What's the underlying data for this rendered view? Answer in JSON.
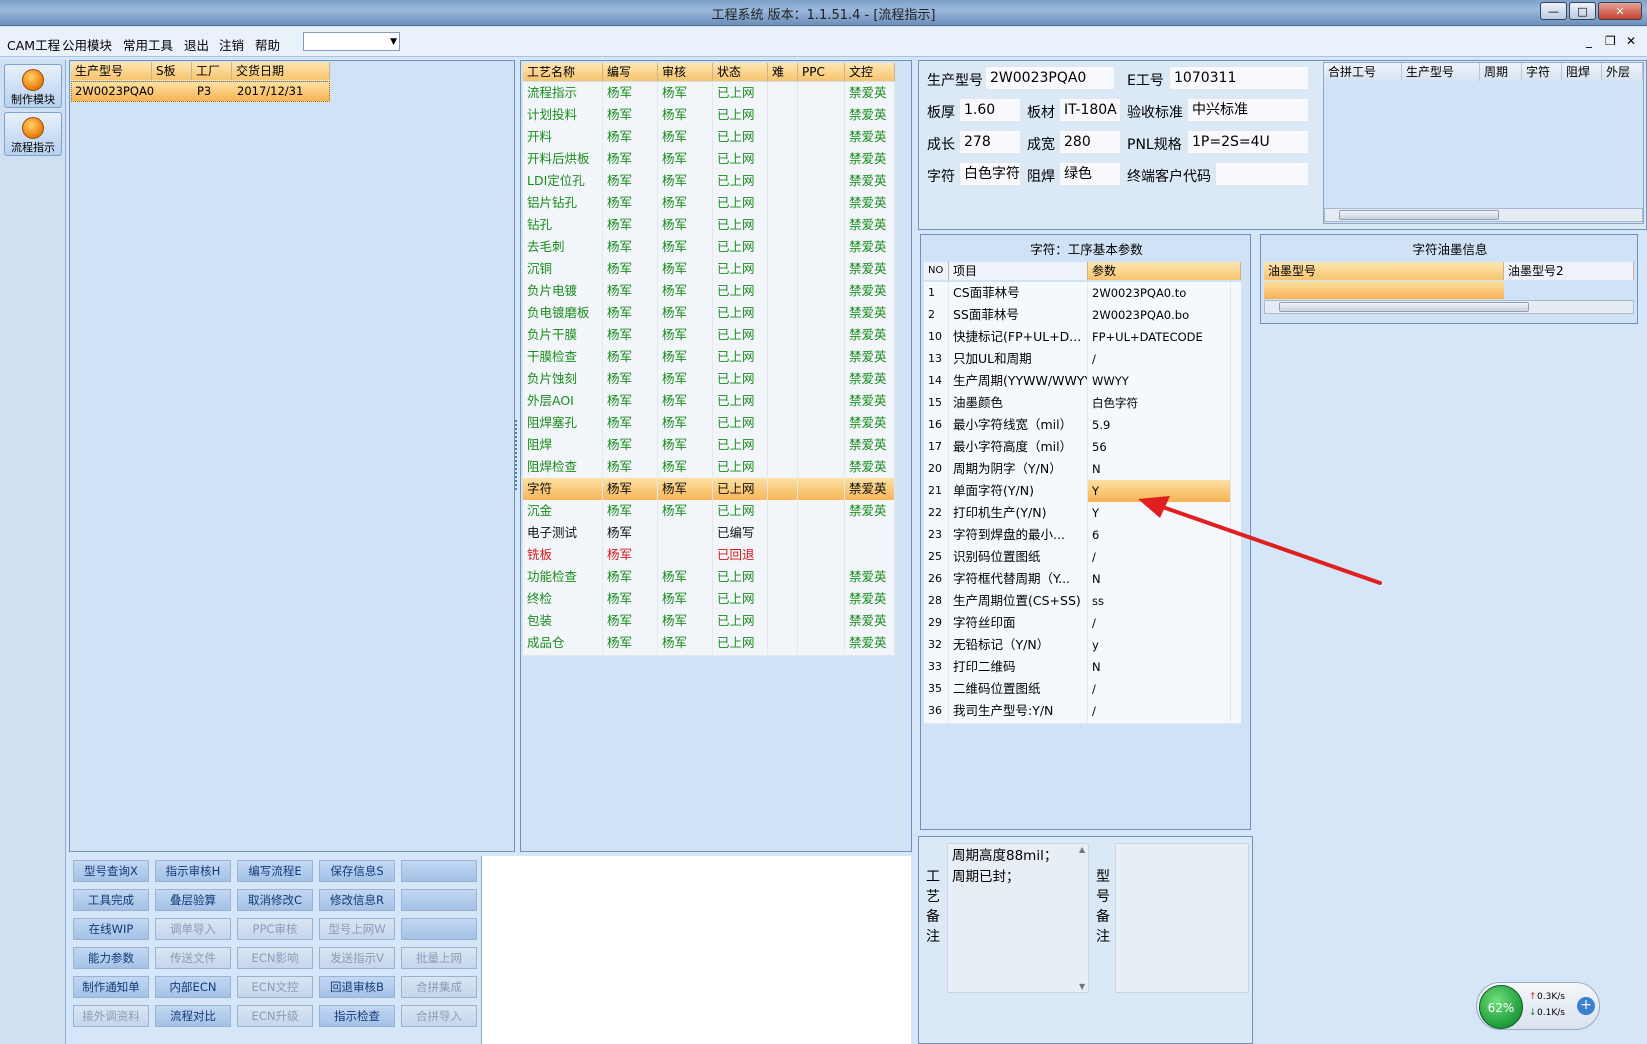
{
  "window": {
    "title": "工程系统   版本：1.1.51.4 - [流程指示]"
  },
  "menu": {
    "items": [
      "CAM工程",
      "公用模块",
      "常用工具",
      "退出",
      "注销",
      "帮助"
    ],
    "select_value": ""
  },
  "leftnav": {
    "items": [
      "制作模块",
      "流程指示"
    ]
  },
  "orders": {
    "headers": [
      "生产型号",
      "S板",
      "工厂",
      "交货日期"
    ],
    "rows": [
      [
        "2W0023PQA0",
        "",
        "P3",
        "2017/12/31"
      ]
    ]
  },
  "process": {
    "headers": [
      "工艺名称",
      "编写",
      "审核",
      "状态",
      "难",
      "PPC",
      "文控"
    ],
    "rows": [
      {
        "name": "流程指示",
        "w": "杨军",
        "r": "杨军",
        "s": "已上网",
        "d": "",
        "p": "",
        "c": "禁爱英",
        "color": "green"
      },
      {
        "name": "计划投料",
        "w": "杨军",
        "r": "杨军",
        "s": "已上网",
        "d": "",
        "p": "",
        "c": "禁爱英",
        "color": "green"
      },
      {
        "name": "开料",
        "w": "杨军",
        "r": "杨军",
        "s": "已上网",
        "d": "",
        "p": "",
        "c": "禁爱英",
        "color": "green"
      },
      {
        "name": "开料后烘板",
        "w": "杨军",
        "r": "杨军",
        "s": "已上网",
        "d": "",
        "p": "",
        "c": "禁爱英",
        "color": "green"
      },
      {
        "name": "LDI定位孔",
        "w": "杨军",
        "r": "杨军",
        "s": "已上网",
        "d": "",
        "p": "",
        "c": "禁爱英",
        "color": "green"
      },
      {
        "name": "铝片钻孔",
        "w": "杨军",
        "r": "杨军",
        "s": "已上网",
        "d": "",
        "p": "",
        "c": "禁爱英",
        "color": "green"
      },
      {
        "name": "钻孔",
        "w": "杨军",
        "r": "杨军",
        "s": "已上网",
        "d": "",
        "p": "",
        "c": "禁爱英",
        "color": "green"
      },
      {
        "name": "去毛刺",
        "w": "杨军",
        "r": "杨军",
        "s": "已上网",
        "d": "",
        "p": "",
        "c": "禁爱英",
        "color": "green"
      },
      {
        "name": "沉铜",
        "w": "杨军",
        "r": "杨军",
        "s": "已上网",
        "d": "",
        "p": "",
        "c": "禁爱英",
        "color": "green"
      },
      {
        "name": "负片电镀",
        "w": "杨军",
        "r": "杨军",
        "s": "已上网",
        "d": "",
        "p": "",
        "c": "禁爱英",
        "color": "green"
      },
      {
        "name": "负电镀磨板",
        "w": "杨军",
        "r": "杨军",
        "s": "已上网",
        "d": "",
        "p": "",
        "c": "禁爱英",
        "color": "green"
      },
      {
        "name": "负片干膜",
        "w": "杨军",
        "r": "杨军",
        "s": "已上网",
        "d": "",
        "p": "",
        "c": "禁爱英",
        "color": "green"
      },
      {
        "name": "干膜检查",
        "w": "杨军",
        "r": "杨军",
        "s": "已上网",
        "d": "",
        "p": "",
        "c": "禁爱英",
        "color": "green"
      },
      {
        "name": "负片蚀刻",
        "w": "杨军",
        "r": "杨军",
        "s": "已上网",
        "d": "",
        "p": "",
        "c": "禁爱英",
        "color": "green"
      },
      {
        "name": "外层AOI",
        "w": "杨军",
        "r": "杨军",
        "s": "已上网",
        "d": "",
        "p": "",
        "c": "禁爱英",
        "color": "green"
      },
      {
        "name": "阻焊塞孔",
        "w": "杨军",
        "r": "杨军",
        "s": "已上网",
        "d": "",
        "p": "",
        "c": "禁爱英",
        "color": "green"
      },
      {
        "name": "阻焊",
        "w": "杨军",
        "r": "杨军",
        "s": "已上网",
        "d": "",
        "p": "",
        "c": "禁爱英",
        "color": "green"
      },
      {
        "name": "阻焊检查",
        "w": "杨军",
        "r": "杨军",
        "s": "已上网",
        "d": "",
        "p": "",
        "c": "禁爱英",
        "color": "green"
      },
      {
        "name": "字符",
        "w": "杨军",
        "r": "杨军",
        "s": "已上网",
        "d": "",
        "p": "",
        "c": "禁爱英",
        "color": "black",
        "selected": true
      },
      {
        "name": "沉金",
        "w": "杨军",
        "r": "杨军",
        "s": "已上网",
        "d": "",
        "p": "",
        "c": "禁爱英",
        "color": "green"
      },
      {
        "name": "电子测试",
        "w": "杨军",
        "r": "",
        "s": "已编写",
        "d": "",
        "p": "",
        "c": "",
        "color": "black"
      },
      {
        "name": "铣板",
        "w": "杨军",
        "r": "",
        "s": "已回退",
        "d": "",
        "p": "",
        "c": "",
        "color": "red"
      },
      {
        "name": "功能检查",
        "w": "杨军",
        "r": "杨军",
        "s": "已上网",
        "d": "",
        "p": "",
        "c": "禁爱英",
        "color": "green"
      },
      {
        "name": "终检",
        "w": "杨军",
        "r": "杨军",
        "s": "已上网",
        "d": "",
        "p": "",
        "c": "禁爱英",
        "color": "green"
      },
      {
        "name": "包装",
        "w": "杨军",
        "r": "杨军",
        "s": "已上网",
        "d": "",
        "p": "",
        "c": "禁爱英",
        "color": "green"
      },
      {
        "name": "成品仓",
        "w": "杨军",
        "r": "杨军",
        "s": "已上网",
        "d": "",
        "p": "",
        "c": "禁爱英",
        "color": "green"
      }
    ]
  },
  "info": {
    "model_label": "生产型号",
    "model": "2W0023PQA0",
    "eno_label": "E工号",
    "eno": "1070311",
    "thick_label": "板厚",
    "thick": "1.60",
    "material_label": "板材",
    "material": "IT-180A",
    "accept_label": "验收标准",
    "accept": "中兴标准",
    "len_label": "成长",
    "len": "278",
    "wid_label": "成宽",
    "wid": "280",
    "pnl_label": "PNL规格",
    "pnl": "1P=2S=4U",
    "char_label": "字符",
    "char": "白色字符",
    "mask_label": "阻焊",
    "mask": "绿色",
    "cust_label": "终端客户代码",
    "cust": ""
  },
  "merge": {
    "headers": [
      "合拼工号",
      "生产型号",
      "周期",
      "字符",
      "阻焊",
      "外层"
    ]
  },
  "params": {
    "title": "字符：工序基本参数",
    "headers": [
      "NO",
      "项目",
      "参数"
    ],
    "rows": [
      {
        "no": "1",
        "item": "CS面菲林号",
        "val": "2W0023PQA0.to"
      },
      {
        "no": "2",
        "item": "SS面菲林号",
        "val": "2W0023PQA0.bo"
      },
      {
        "no": "10",
        "item": "快捷标记(FP+UL+D...",
        "val": "FP+UL+DATECODE"
      },
      {
        "no": "13",
        "item": "只加UL和周期",
        "val": "/"
      },
      {
        "no": "14",
        "item": "生产周期(YYWW/WWYY)",
        "val": "WWYY"
      },
      {
        "no": "15",
        "item": "油墨颜色",
        "val": "白色字符"
      },
      {
        "no": "16",
        "item": "最小字符线宽（mil）",
        "val": "5.9"
      },
      {
        "no": "17",
        "item": "最小字符高度（mil）",
        "val": "56"
      },
      {
        "no": "20",
        "item": "周期为阴字（Y/N）",
        "val": "N"
      },
      {
        "no": "21",
        "item": "单面字符(Y/N)",
        "val": "Y",
        "selected": true
      },
      {
        "no": "22",
        "item": "打印机生产(Y/N)",
        "val": "Y"
      },
      {
        "no": "23",
        "item": "字符到焊盘的最小...",
        "val": "6"
      },
      {
        "no": "25",
        "item": "识别码位置图纸",
        "val": "/"
      },
      {
        "no": "26",
        "item": "字符框代替周期（Y...",
        "val": "N"
      },
      {
        "no": "28",
        "item": "生产周期位置(CS+SS)",
        "val": "ss"
      },
      {
        "no": "29",
        "item": "字符丝印面",
        "val": "/"
      },
      {
        "no": "32",
        "item": "无铅标记（Y/N）",
        "val": "y"
      },
      {
        "no": "33",
        "item": "打印二维码",
        "val": "N"
      },
      {
        "no": "35",
        "item": "二维码位置图纸",
        "val": "/"
      },
      {
        "no": "36",
        "item": "我司生产型号:Y/N",
        "val": "/"
      }
    ]
  },
  "ink": {
    "title": "字符油墨信息",
    "headers": [
      "油墨型号",
      "油墨型号2"
    ]
  },
  "notes": {
    "process_label": [
      "工",
      "艺",
      "备",
      "注"
    ],
    "process_text": "周期高度88mil；\n周期已封；",
    "model_label": [
      "型",
      "号",
      "备",
      "注"
    ],
    "model_text": ""
  },
  "buttons": [
    [
      {
        "t": "型号查询X",
        "d": false
      },
      {
        "t": "指示审核H",
        "d": false
      },
      {
        "t": "编写流程E",
        "d": false
      },
      {
        "t": "保存信息S",
        "d": false
      },
      {
        "t": "",
        "d": false
      }
    ],
    [
      {
        "t": "工具完成",
        "d": false
      },
      {
        "t": "叠层验算",
        "d": false
      },
      {
        "t": "取消修改C",
        "d": false
      },
      {
        "t": "修改信息R",
        "d": false
      },
      {
        "t": "",
        "d": false
      }
    ],
    [
      {
        "t": "在线WIP",
        "d": false
      },
      {
        "t": "调单导入",
        "d": true
      },
      {
        "t": "PPC审核",
        "d": true
      },
      {
        "t": "型号上网W",
        "d": true
      },
      {
        "t": "",
        "d": false
      }
    ],
    [
      {
        "t": "能力参数",
        "d": false
      },
      {
        "t": "传送文件",
        "d": true
      },
      {
        "t": "ECN影响",
        "d": true
      },
      {
        "t": "发送指示V",
        "d": true
      },
      {
        "t": "批量上网",
        "d": true
      }
    ],
    [
      {
        "t": "制作通知单",
        "d": false
      },
      {
        "t": "内部ECN",
        "d": false
      },
      {
        "t": "ECN文控",
        "d": true
      },
      {
        "t": "回退审核B",
        "d": false
      },
      {
        "t": "合拼集成",
        "d": true
      }
    ],
    [
      {
        "t": "接外调资料",
        "d": true
      },
      {
        "t": "流程对比",
        "d": false
      },
      {
        "t": "ECN升级",
        "d": true
      },
      {
        "t": "指示检查",
        "d": false
      },
      {
        "t": "合拼导入",
        "d": true
      }
    ]
  ],
  "netmon": {
    "percent": "62%",
    "up": "0.3K/s",
    "down": "0.1K/s"
  },
  "colors": {
    "accent": "#f6b354",
    "green": "#1a8c1a",
    "red": "#d21b1b",
    "arrow": "#e02020"
  }
}
